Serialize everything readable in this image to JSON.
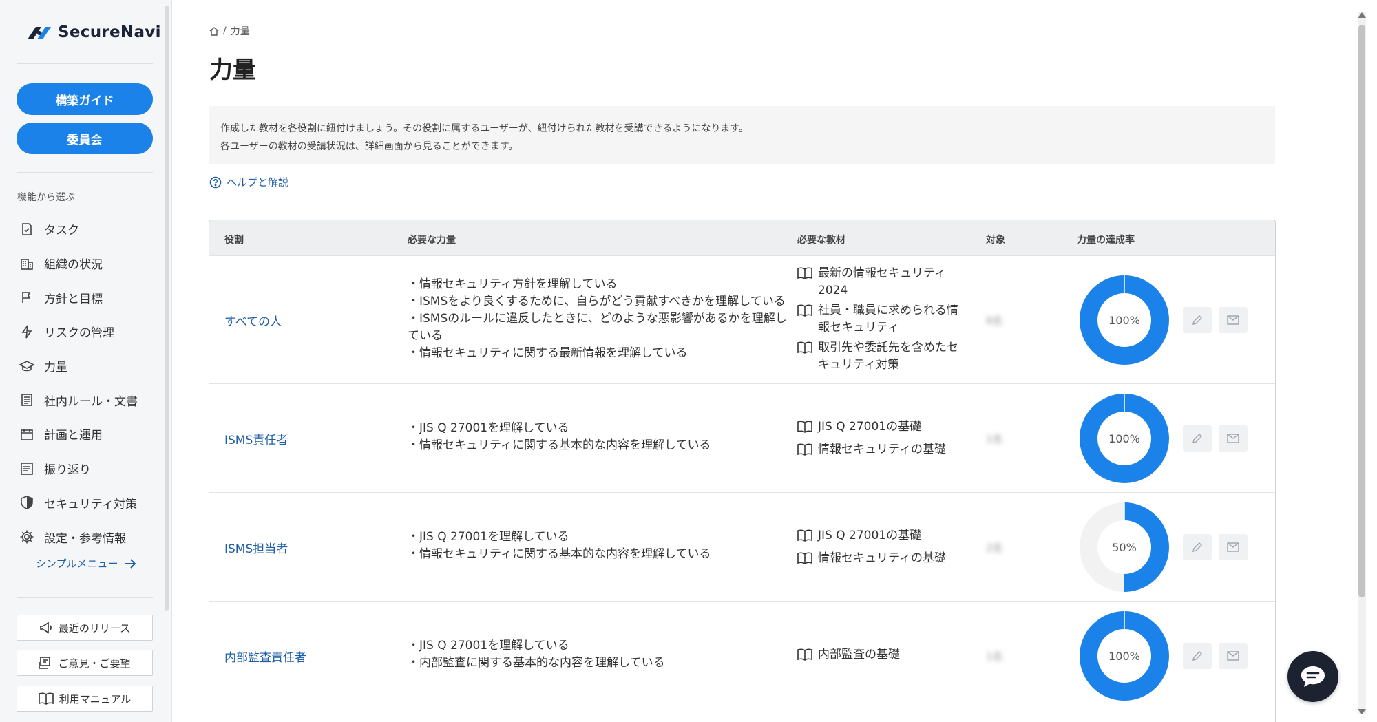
{
  "brand": {
    "name": "SecureNavi",
    "accent": "#1a82e8",
    "link": "#1f5fa8"
  },
  "sidebar": {
    "guide_button": "構築ガイド",
    "committee_button": "委員会",
    "section_label": "機能から選ぶ",
    "items": [
      {
        "label": "タスク",
        "icon": "task-check-icon"
      },
      {
        "label": "組織の状況",
        "icon": "building-icon"
      },
      {
        "label": "方針と目標",
        "icon": "flag-icon"
      },
      {
        "label": "リスクの管理",
        "icon": "lightning-icon"
      },
      {
        "label": "力量",
        "icon": "graduation-cap-icon"
      },
      {
        "label": "社内ルール・文書",
        "icon": "document-icon"
      },
      {
        "label": "計画と運用",
        "icon": "calendar-icon"
      },
      {
        "label": "振り返り",
        "icon": "review-list-icon"
      },
      {
        "label": "セキュリティ対策",
        "icon": "shield-icon"
      },
      {
        "label": "設定・参考情報",
        "icon": "gear-icon"
      }
    ],
    "simple_menu": "シンプルメニュー",
    "bottom_buttons": [
      {
        "label": "最近のリリース",
        "icon": "megaphone-icon"
      },
      {
        "label": "ご意見・ご要望",
        "icon": "feedback-icon"
      },
      {
        "label": "利用マニュアル",
        "icon": "book-icon"
      }
    ]
  },
  "breadcrumb": {
    "current": "力量"
  },
  "page": {
    "title": "力量",
    "info_line1": "作成した教材を各役割に紐付けましょう。その役割に属するユーザーが、紐付けられた教材を受講できるようになります。",
    "info_line2": "各ユーザーの教材の受講状況は、詳細画面から見ることができます。",
    "help_link": "ヘルプと解説"
  },
  "table": {
    "headers": {
      "role": "役割",
      "skills": "必要な力量",
      "materials": "必要な教材",
      "target": "対象",
      "rate": "力量の達成率"
    },
    "rows": [
      {
        "role": "すべての人",
        "skills": [
          "・情報セキュリティ方針を理解している",
          "・ISMSをより良くするために、自らがどう貢献すべきかを理解している",
          "・ISMSのルールに違反したときに、どのような悪影響があるかを理解している",
          "・情報セキュリティに関する最新情報を理解している"
        ],
        "materials": [
          "最新の情報セキュリティ 2024",
          "社員・職員に求められる情報セキュリティ",
          "取引先や委託先を含めたセキュリティ対策"
        ],
        "target": "8名",
        "rate": 100,
        "rate_label": "100%"
      },
      {
        "role": "ISMS責任者",
        "skills": [
          "・JIS Q 27001を理解している",
          "・情報セキュリティに関する基本的な内容を理解している"
        ],
        "materials": [
          "JIS Q 27001の基礎",
          "情報セキュリティの基礎"
        ],
        "target": "1名",
        "rate": 100,
        "rate_label": "100%"
      },
      {
        "role": "ISMS担当者",
        "skills": [
          "・JIS Q 27001を理解している",
          "・情報セキュリティに関する基本的な内容を理解している"
        ],
        "materials": [
          "JIS Q 27001の基礎",
          "情報セキュリティの基礎"
        ],
        "target": "2名",
        "rate": 50,
        "rate_label": "50%"
      },
      {
        "role": "内部監査責任者",
        "skills": [
          "・JIS Q 27001を理解している",
          "・内部監査に関する基本的な内容を理解している"
        ],
        "materials": [
          "内部監査の基礎"
        ],
        "target": "1名",
        "rate": 100,
        "rate_label": "100%"
      }
    ]
  }
}
